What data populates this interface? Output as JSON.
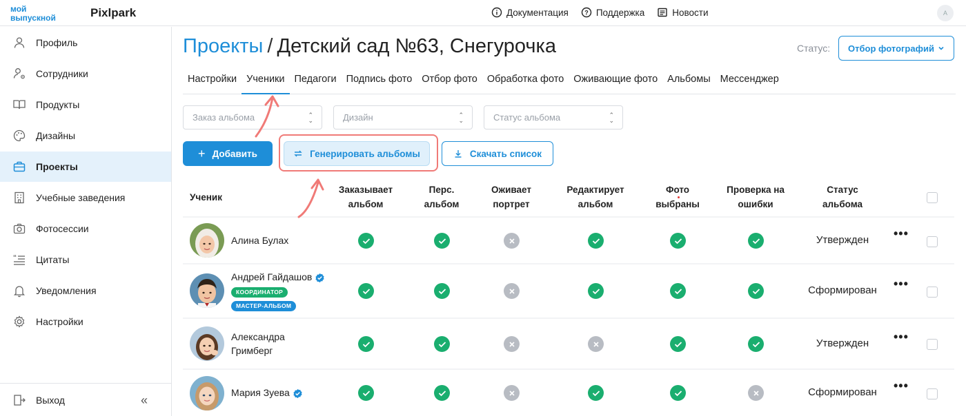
{
  "header": {
    "logo_line1": "мой",
    "logo_line2": "выпускной",
    "brand": "Pixlpark",
    "links": [
      {
        "label": "Документация",
        "icon": "info-icon"
      },
      {
        "label": "Поддержка",
        "icon": "help-icon"
      },
      {
        "label": "Новости",
        "icon": "news-icon"
      }
    ],
    "user_initial": "A"
  },
  "sidebar": {
    "items": [
      {
        "label": "Профиль",
        "icon": "user-icon"
      },
      {
        "label": "Сотрудники",
        "icon": "staff-icon"
      },
      {
        "label": "Продукты",
        "icon": "book-icon"
      },
      {
        "label": "Дизайны",
        "icon": "palette-icon"
      },
      {
        "label": "Проекты",
        "icon": "briefcase-icon",
        "active": true
      },
      {
        "label": "Учебные заведения",
        "icon": "building-icon"
      },
      {
        "label": "Фотосессии",
        "icon": "camera-icon"
      },
      {
        "label": "Цитаты",
        "icon": "quote-icon"
      },
      {
        "label": "Уведомления",
        "icon": "bell-icon"
      },
      {
        "label": "Настройки",
        "icon": "gear-icon"
      }
    ],
    "logout": "Выход"
  },
  "page": {
    "breadcrumb": "Проекты",
    "separator": "/",
    "title": "Детский сад №63, Снегурочка",
    "status_label": "Статус:",
    "status_value": "Отбор фотографий"
  },
  "tabs": [
    "Настройки",
    "Ученики",
    "Педагоги",
    "Подпись фото",
    "Отбор фото",
    "Обработка фото",
    "Оживающие фото",
    "Альбомы",
    "Мессенджер"
  ],
  "active_tab": "Ученики",
  "filters": {
    "album_order": "Заказ альбома",
    "design": "Дизайн",
    "album_status": "Статус альбома"
  },
  "actions": {
    "add": "Добавить",
    "generate": "Генерировать альбомы",
    "download": "Скачать список"
  },
  "table": {
    "columns": {
      "student": "Ученик",
      "orders_album": [
        "Заказывает",
        "альбом"
      ],
      "personal_album": [
        "Перс.",
        "альбом"
      ],
      "animates_portrait": [
        "Оживает",
        "портрет"
      ],
      "edits_album": [
        "Редактирует",
        "альбом"
      ],
      "photos_selected": [
        "Фото",
        "выбраны"
      ],
      "error_check": [
        "Проверка на",
        "ошибки"
      ],
      "album_status": [
        "Статус",
        "альбома"
      ]
    },
    "rows": [
      {
        "name": "Алина Булах",
        "verified": false,
        "badges": [],
        "checks": [
          true,
          true,
          false,
          true,
          true,
          true
        ],
        "status": "Утвержден"
      },
      {
        "name": "Андрей Гайдашов",
        "verified": true,
        "badges": [
          "КООРДИНАТОР",
          "МАСТЕР-АЛЬБОМ"
        ],
        "checks": [
          true,
          true,
          false,
          true,
          true,
          true
        ],
        "status": "Сформирован"
      },
      {
        "name_line1": "Александра",
        "name_line2": "Гримберг",
        "verified": false,
        "badges": [],
        "checks": [
          true,
          true,
          false,
          false,
          true,
          true
        ],
        "status": "Утвержден"
      },
      {
        "name": "Мария Зуева",
        "verified": true,
        "badges": [],
        "checks": [
          true,
          true,
          false,
          true,
          true,
          false
        ],
        "status": "Сформирован"
      }
    ]
  },
  "colors": {
    "accent": "#1e8ed8",
    "success": "#1aae6f",
    "neutral": "#b8bcc3",
    "highlight": "#f07a77"
  }
}
